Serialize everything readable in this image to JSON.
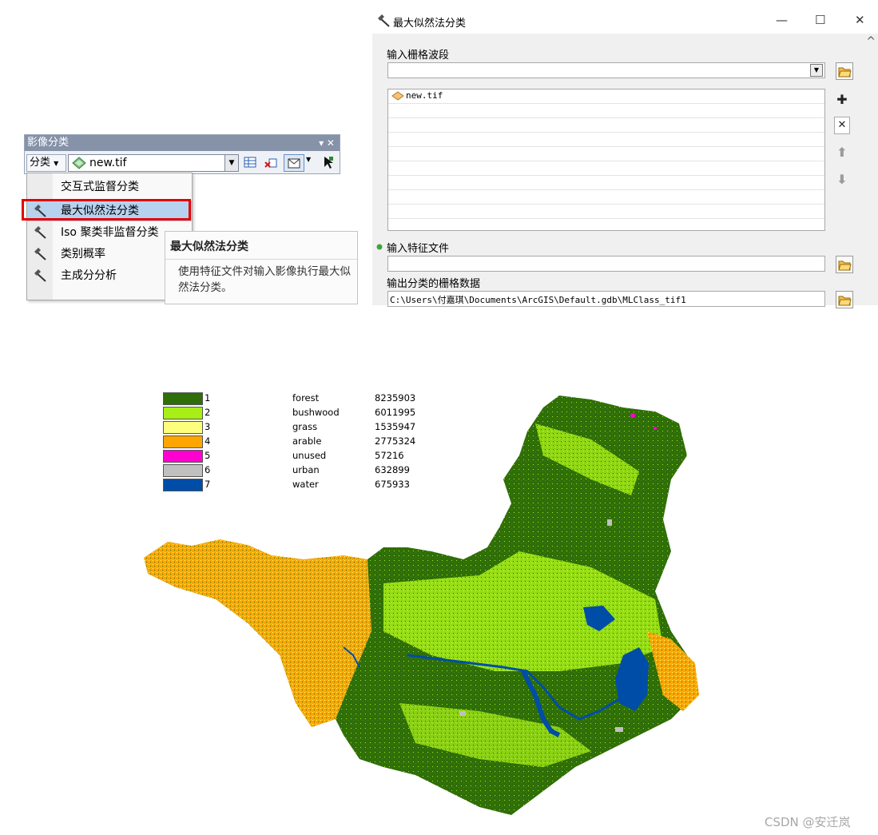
{
  "toolbar": {
    "title": "影像分类",
    "title_controls": "▾ ✕",
    "classify_label": "分类",
    "layer_value": "new.tif",
    "icons": [
      "layer-raster-icon",
      "training-manager-icon",
      "clear-samples-icon",
      "draw-polygon-icon",
      "select-pointer-icon"
    ]
  },
  "menu": {
    "items": [
      {
        "label": "交互式监督分类",
        "icon": ""
      },
      {
        "label": "最大似然法分类",
        "icon": "hammer-icon"
      },
      {
        "label": "Iso 聚类非监督分类",
        "icon": "hammer-icon"
      },
      {
        "label": "类别概率",
        "icon": "hammer-icon"
      },
      {
        "label": "主成分分析",
        "icon": "hammer-icon"
      }
    ],
    "selected_index": 1
  },
  "tooltip": {
    "title": "最大似然法分类",
    "body": "使用特征文件对输入影像执行最大似然法分类。"
  },
  "dialog": {
    "title": "最大似然法分类",
    "window_buttons": {
      "minimize": "—",
      "maximize": "☐",
      "close": "✕"
    },
    "input_raster_label": "输入栅格波段",
    "input_raster_value": "",
    "list_items": [
      "new.tif"
    ],
    "signature_label": "输入特征文件",
    "signature_value": "",
    "output_label": "输出分类的栅格数据",
    "output_value": "C:\\Users\\付嘉琪\\Documents\\ArcGIS\\Default.gdb\\MLClass_tif1",
    "side_buttons": {
      "add": "✚",
      "remove": "✕",
      "up": "⬆",
      "down": "⬇"
    }
  },
  "legend": {
    "rows": [
      {
        "value": "1",
        "name": "forest",
        "count": "8235903",
        "color": "#2f6e08"
      },
      {
        "value": "2",
        "name": "bushwood",
        "count": "6011995",
        "color": "#a7ef17"
      },
      {
        "value": "3",
        "name": "grass",
        "count": "1535947",
        "color": "#fdff7c"
      },
      {
        "value": "4",
        "name": "arable",
        "count": "2775324",
        "color": "#ffa500"
      },
      {
        "value": "5",
        "name": "unused",
        "count": "57216",
        "color": "#ff00d0"
      },
      {
        "value": "6",
        "name": "urban",
        "count": "632899",
        "color": "#c0c0c0"
      },
      {
        "value": "7",
        "name": "water",
        "count": "675933",
        "color": "#004da8"
      }
    ]
  },
  "watermark": "CSDN @安迁岚"
}
